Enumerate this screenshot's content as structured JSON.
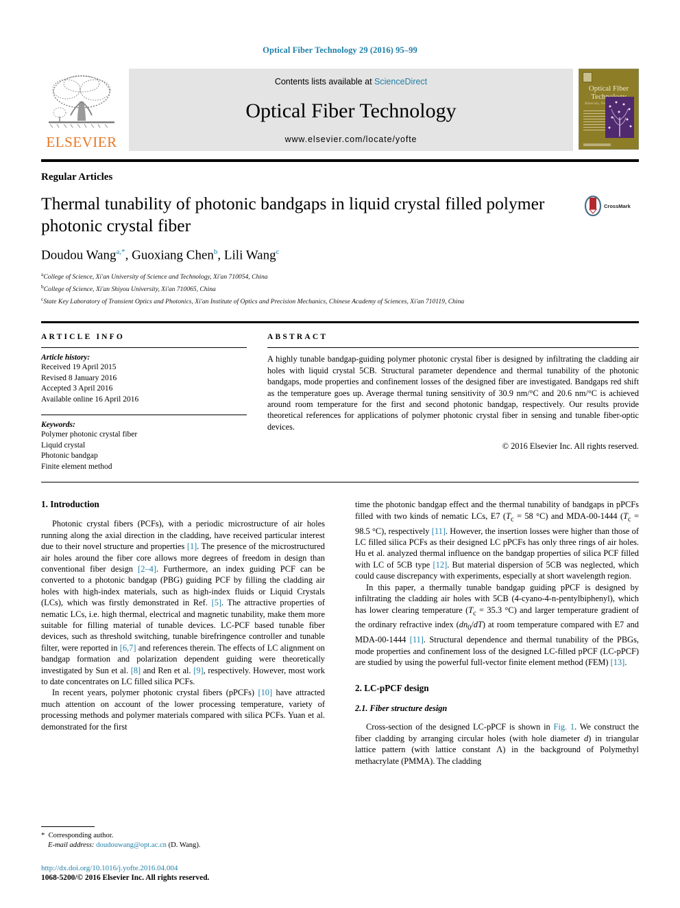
{
  "running_head": "Optical Fiber Technology 29 (2016) 95–99",
  "masthead": {
    "publisher_name": "ELSEVIER",
    "contents_prefix": "Contents lists available at ",
    "sciencedirect": "ScienceDirect",
    "journal_title": "Optical Fiber Technology",
    "journal_url": "www.elsevier.com/locate/yofte",
    "cover": {
      "title_line1": "Optical Fiber",
      "title_line2": "Technology",
      "subtitle": "Materials, Devices and Systems"
    }
  },
  "article": {
    "kicker": "Regular Articles",
    "title": "Thermal tunability of photonic bandgaps in liquid crystal filled polymer photonic crystal fiber",
    "crossmark_label": "CrossMark",
    "authors": [
      {
        "name": "Doudou Wang",
        "marks": "a,*"
      },
      {
        "name": "Guoxiang Chen",
        "marks": "b"
      },
      {
        "name": "Lili Wang",
        "marks": "c"
      }
    ],
    "affiliations": [
      {
        "mark": "a",
        "text": "College of Science, Xi'an University of Science and Technology, Xi'an 710054, China"
      },
      {
        "mark": "b",
        "text": "College of Science, Xi'an Shiyou University, Xi'an 710065, China"
      },
      {
        "mark": "c",
        "text": "State Key Laboratory of Transient Optics and Photonics, Xi'an Institute of Optics and Precision Mechanics, Chinese Academy of Sciences, Xi'an 710119, China"
      }
    ]
  },
  "article_info": {
    "label": "ARTICLE INFO",
    "history_label": "Article history:",
    "history": [
      "Received 19 April 2015",
      "Revised 8 January 2016",
      "Accepted 3 April 2016",
      "Available online 16 April 2016"
    ],
    "keywords_label": "Keywords:",
    "keywords": [
      "Polymer photonic crystal fiber",
      "Liquid crystal",
      "Photonic bandgap",
      "Finite element method"
    ]
  },
  "abstract": {
    "label": "ABSTRACT",
    "text": "A highly tunable bandgap-guiding polymer photonic crystal fiber is designed by infiltrating the cladding air holes with liquid crystal 5CB. Structural parameter dependence and thermal tunability of the photonic bandgaps, mode properties and confinement losses of the designed fiber are investigated. Bandgaps red shift as the temperature goes up. Average thermal tuning sensitivity of 30.9 nm/°C and 20.6 nm/°C is achieved around room temperature for the first and second photonic bandgap, respectively. Our results provide theoretical references for applications of polymer photonic crystal fiber in sensing and tunable fiber-optic devices.",
    "copyright": "© 2016 Elsevier Inc. All rights reserved."
  },
  "body": {
    "intro_heading": "1. Introduction",
    "left_p1": "Photonic crystal fibers (PCFs), with a periodic microstructure of air holes running along the axial direction in the cladding, have received particular interest due to their novel structure and properties [1]. The presence of the microstructured air holes around the fiber core allows more degrees of freedom in design than conventional fiber design [2–4]. Furthermore, an index guiding PCF can be converted to a photonic bandgap (PBG) guiding PCF by filling the cladding air holes with high-index materials, such as high-index fluids or Liquid Crystals (LCs), which was firstly demonstrated in Ref. [5]. The attractive properties of nematic LCs, i.e. high thermal, electrical and magnetic tunability, make them more suitable for filling material of tunable devices. LC-PCF based tunable fiber devices, such as threshold switching, tunable birefringence controller and tunable filter, were reported in [6,7] and references therein. The effects of LC alignment on bandgap formation and polarization dependent guiding were theoretically investigated by Sun et al. [8] and Ren et al. [9], respectively. However, most work to date concentrates on LC filled silica PCFs.",
    "left_p2": "In recent years, polymer photonic crystal fibers (pPCFs) [10] have attracted much attention on account of the lower processing temperature, variety of processing methods and polymer materials compared with silica PCFs. Yuan et al. demonstrated for the first",
    "right_p1": "time the photonic bandgap effect and the thermal tunability of bandgaps in pPCFs filled with two kinds of nematic LCs, E7 (Tc = 58 °C) and MDA-00-1444 (Tc = 98.5 °C), respectively [11]. However, the insertion losses were higher than those of LC filled silica PCFs as their designed LC pPCFs has only three rings of air holes. Hu et al. analyzed thermal influence on the bandgap properties of silica PCF filled with LC of 5CB type [12]. But material dispersion of 5CB was neglected, which could cause discrepancy with experiments, especially at short wavelength region.",
    "right_p2": "In this paper, a thermally tunable bandgap guiding pPCF is designed by infiltrating the cladding air holes with 5CB (4-cyano-4-n-pentylbiphenyl), which has lower clearing temperature (Tc = 35.3 °C) and larger temperature gradient of the ordinary refractive index (dn0/dT) at room temperature compared with E7 and MDA-00-1444 [11]. Structural dependence and thermal tunability of the PBGs, mode properties and confinement loss of the designed LC-filled pPCF (LC-pPCF) are studied by using the powerful full-vector finite element method (FEM) [13].",
    "design_heading": "2. LC-pPCF design",
    "design_sub": "2.1. Fiber structure design",
    "right_p3": "Cross-section of the designed LC-pPCF is shown in Fig. 1. We construct the fiber cladding by arranging circular holes (with hole diameter d) in triangular lattice pattern (with lattice constant Λ) in the background of Polymethyl methacrylate (PMMA). The cladding"
  },
  "footnote": {
    "corresponding": "Corresponding author.",
    "email_label": "E-mail address:",
    "email": "doudouwang@opt.ac.cn",
    "email_suffix": "(D. Wang)."
  },
  "footer": {
    "doi": "http://dx.doi.org/10.1016/j.yofte.2016.04.004",
    "issn_line": "1068-5200/© 2016 Elsevier Inc. All rights reserved."
  },
  "colors": {
    "link": "#1f7fa8",
    "elsevier_orange": "#e87722",
    "banner_gray": "#e4e4e4",
    "cover_olive": "#8d7d27",
    "cover_purple": "#4f2a6e",
    "crossmark_red": "#b3282d"
  }
}
